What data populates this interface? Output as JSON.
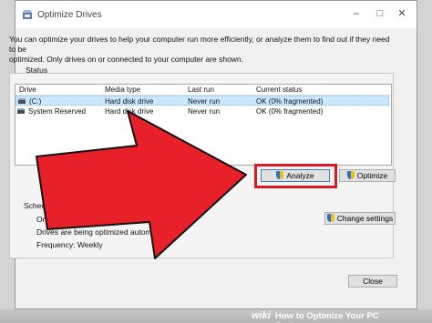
{
  "window": {
    "title": "Optimize Drives",
    "controls": {
      "minimize": "–",
      "maximize": "□",
      "close": "✕"
    }
  },
  "intro": {
    "line1": "You can optimize your drives to help your computer run more efficiently, or analyze them to find out if they need to be",
    "line2": "optimized. Only drives on or connected to your computer are shown."
  },
  "status": {
    "label": "Status",
    "columns": [
      "Drive",
      "Media type",
      "Last run",
      "Current status"
    ],
    "rows": [
      {
        "drive": "(C:)",
        "media_type": "Hard disk drive",
        "last_run": "Never run",
        "current_status": "OK (0% fragmented)",
        "selected": true
      },
      {
        "drive": "System Reserved",
        "media_type": "Hard disk drive",
        "last_run": "Never run",
        "current_status": "OK (0% fragmented)",
        "selected": false
      }
    ],
    "analyze_label": "Analyze",
    "optimize_label": "Optimize"
  },
  "scheduled": {
    "label": "Scheduled optimization",
    "status": "On",
    "description": "Drives are being optimized automatically.",
    "frequency": "Frequency: Weekly",
    "change_label": "Change settings"
  },
  "close_label": "Close",
  "watermark": {
    "brand": "wiki",
    "title": "How to Optimize Your PC Performance"
  },
  "colors": {
    "highlight": "#d51d23",
    "arrow_fill": "#e8202a",
    "selection": "#cce8ff"
  }
}
